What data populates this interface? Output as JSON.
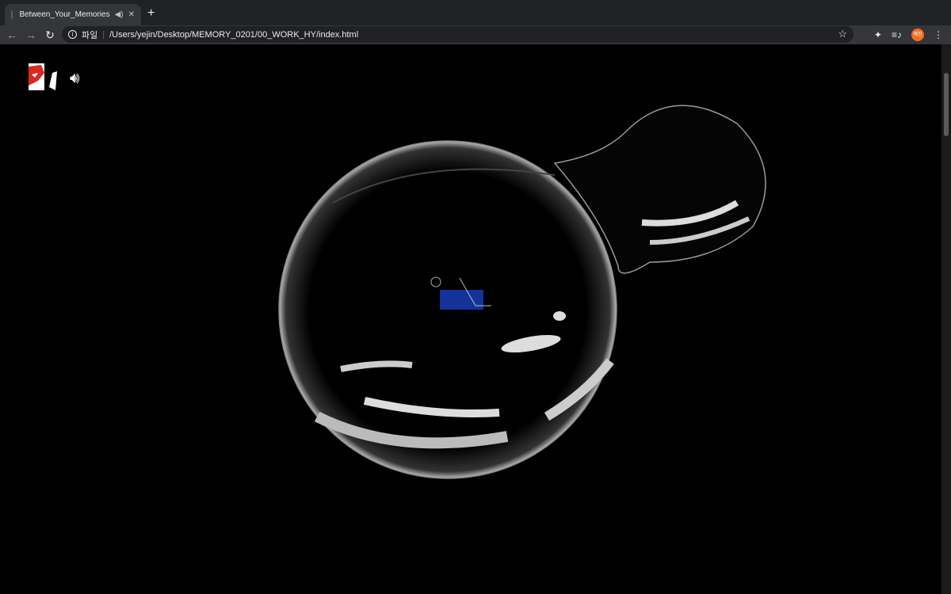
{
  "browser": {
    "tab_title": "Between_Your_Memories",
    "tab_audio_icon": "speaker-icon",
    "new_tab_label": "+",
    "address_scheme_label": "파일",
    "address_url": "/Users/yejin/Desktop/MEMORY_0201/00_WORK_HY/index.html",
    "profile_initials": "예진",
    "profile_color": "#f36e21"
  },
  "page": {
    "sound_icon": "speaker-on-icon",
    "background": "#000000"
  }
}
